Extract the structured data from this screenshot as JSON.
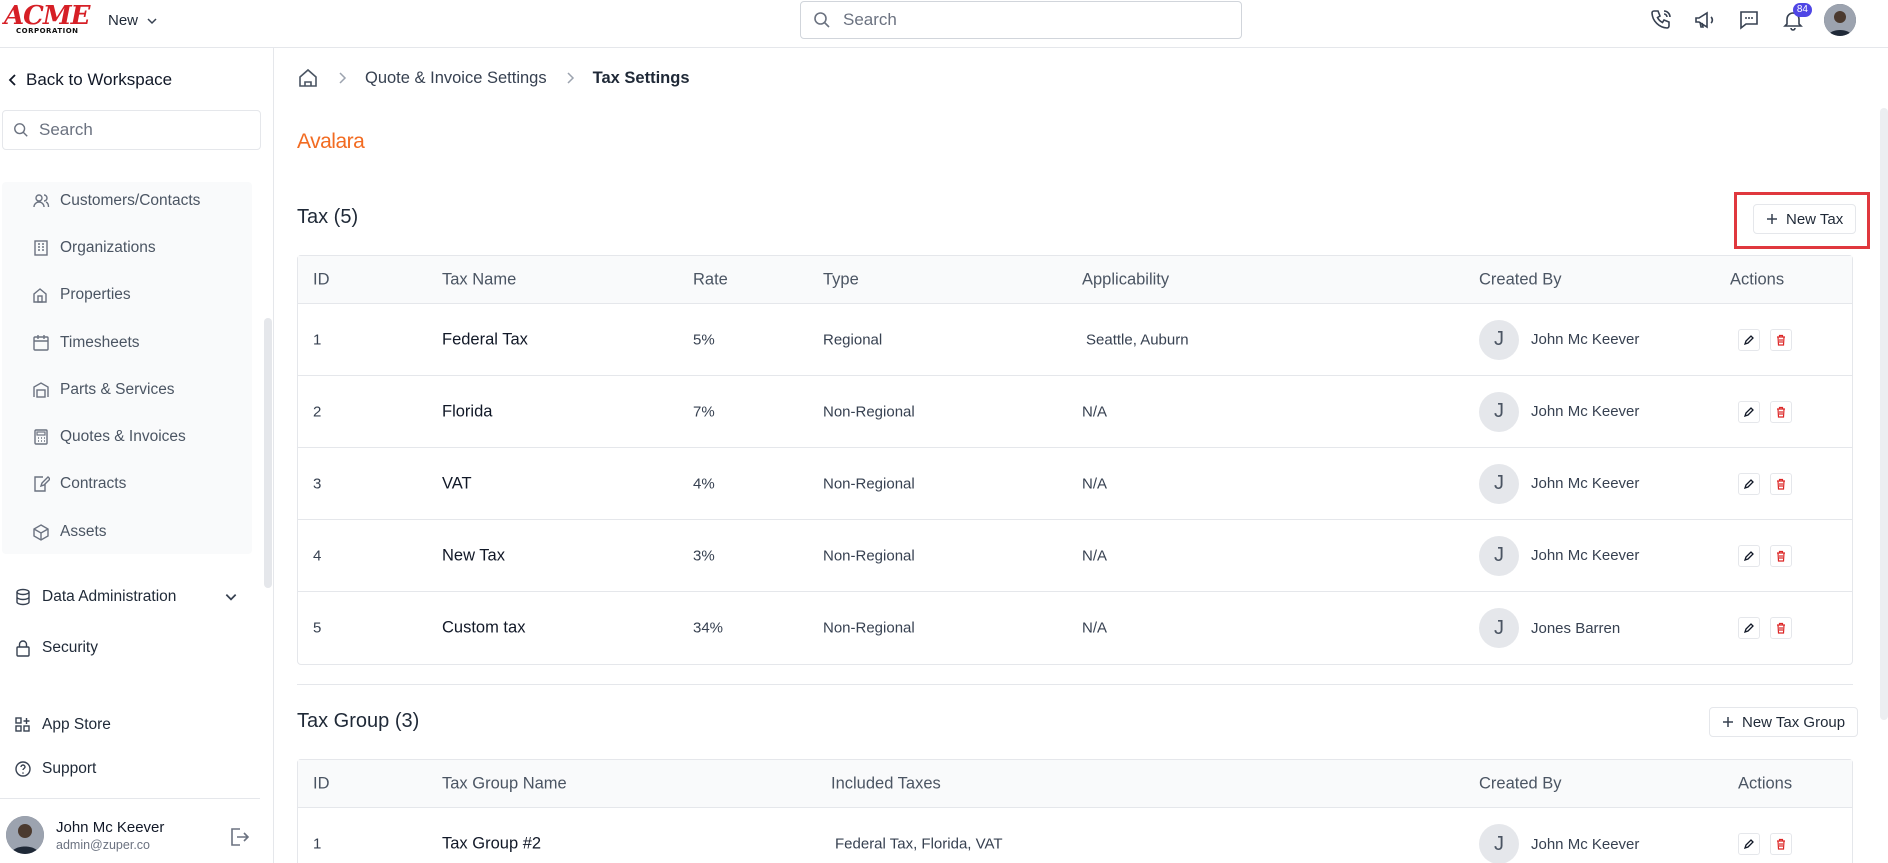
{
  "topbar": {
    "logo_text": "ACME",
    "logo_sub": "CORPORATION",
    "new_label": "New",
    "search_placeholder": "Search",
    "notification_count": "84"
  },
  "sidebar": {
    "back_label": "Back to Workspace",
    "search_placeholder": "Search",
    "items": [
      {
        "label": "Customers/Contacts",
        "icon": "users-icon"
      },
      {
        "label": "Organizations",
        "icon": "building-icon"
      },
      {
        "label": "Properties",
        "icon": "property-icon"
      },
      {
        "label": "Timesheets",
        "icon": "calendar-icon"
      },
      {
        "label": "Parts & Services",
        "icon": "parts-icon"
      },
      {
        "label": "Quotes & Invoices",
        "icon": "calculator-icon"
      },
      {
        "label": "Contracts",
        "icon": "contract-icon"
      },
      {
        "label": "Assets",
        "icon": "cube-icon"
      }
    ],
    "data_admin": "Data Administration",
    "security": "Security",
    "app_store": "App Store",
    "support": "Support",
    "user_name": "John Mc Keever",
    "user_email": "admin@zuper.co"
  },
  "breadcrumb": {
    "parent": "Quote & Invoice Settings",
    "current": "Tax Settings"
  },
  "avalara": "Avalara",
  "tax": {
    "title": "Tax (5)",
    "new_button": "New Tax",
    "columns": [
      "ID",
      "Tax Name",
      "Rate",
      "Type",
      "Applicability",
      "Created By",
      "Actions"
    ],
    "rows": [
      {
        "id": "1",
        "name": "Federal Tax",
        "rate": "5%",
        "type": "Regional",
        "applicability": "Seattle, Auburn",
        "initial": "J",
        "created_by": "John Mc Keever"
      },
      {
        "id": "2",
        "name": "Florida",
        "rate": "7%",
        "type": "Non-Regional",
        "applicability": "N/A",
        "initial": "J",
        "created_by": "John Mc Keever"
      },
      {
        "id": "3",
        "name": "VAT",
        "rate": "4%",
        "type": "Non-Regional",
        "applicability": "N/A",
        "initial": "J",
        "created_by": "John Mc Keever"
      },
      {
        "id": "4",
        "name": "New Tax",
        "rate": "3%",
        "type": "Non-Regional",
        "applicability": "N/A",
        "initial": "J",
        "created_by": "John Mc Keever"
      },
      {
        "id": "5",
        "name": "Custom tax",
        "rate": "34%",
        "type": "Non-Regional",
        "applicability": "N/A",
        "initial": "J",
        "created_by": "Jones Barren"
      }
    ]
  },
  "tax_group": {
    "title": "Tax Group (3)",
    "new_button": "New Tax Group",
    "columns": [
      "ID",
      "Tax Group Name",
      "Included Taxes",
      "Created By",
      "Actions"
    ],
    "rows": [
      {
        "id": "1",
        "name": "Tax Group #2",
        "included": "Federal Tax, Florida, VAT",
        "initial": "J",
        "created_by": "John Mc Keever"
      }
    ]
  },
  "colors": {
    "accent": "#4f46e5",
    "danger": "#dc2626",
    "avalara": "#f26b21",
    "highlight": "#e0383e"
  }
}
